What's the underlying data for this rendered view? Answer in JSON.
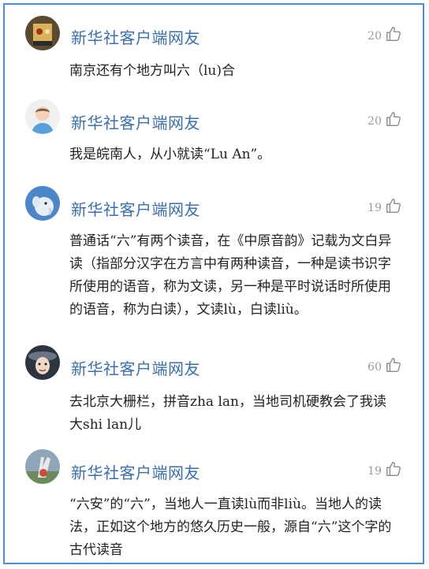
{
  "comments": [
    {
      "username": "新华社客户端网友",
      "likes": "20",
      "text": "南京还有个地方叫六（lu)合"
    },
    {
      "username": "新华社客户端网友",
      "likes": "20",
      "text": "我是皖南人，从小就读“Lu An”。"
    },
    {
      "username": "新华社客户端网友",
      "likes": "19",
      "text": "普通话“六”有两个读音，在《中原音韵》记载为文白异读（指部分汉字在方言中有两种读音，一种是读书识字所使用的语音，称为文读，另一种是平时说话时所使用的语音，称为白读），文读lù，白读liù。"
    },
    {
      "username": "新华社客户端网友",
      "likes": "60",
      "text": "去北京大栅栏，拼音zha lan，当地司机硬教会了我读大shi lan儿"
    },
    {
      "username": "新华社客户端网友",
      "likes": "19",
      "text": "“六安”的“六”，当地人一直读lù而非liù。当地人的读法，正如这个地方的悠久历史一般，源自“六”这个字的古代读音"
    }
  ],
  "icons": {
    "like": "thumbs-up-icon"
  },
  "colors": {
    "username": "#3a6fb4",
    "border": "#4a90d9",
    "likes": "#9a9a9a"
  }
}
